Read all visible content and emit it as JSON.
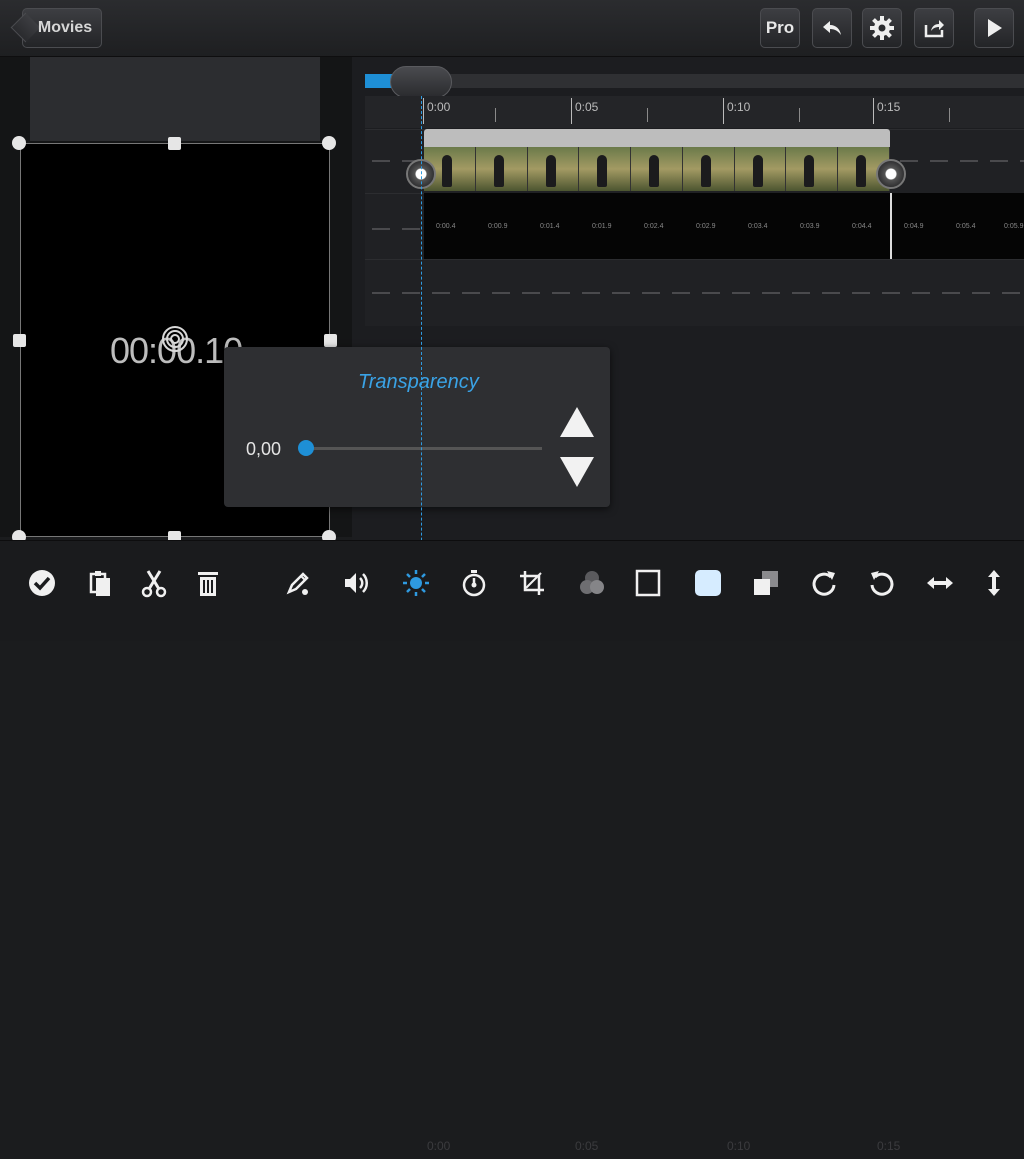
{
  "header": {
    "back_label": "Movies",
    "pro_label": "Pro"
  },
  "preview": {
    "timecode": "00:00.10"
  },
  "timeline": {
    "ruler_labels": [
      "0:00",
      "0:05",
      "0:10",
      "0:15"
    ],
    "audio_labels": [
      "0:00.4",
      "0:00.9",
      "0:01.4",
      "0:01.9",
      "0:02.4",
      "0:02.9",
      "0:03.4",
      "0:03.9",
      "0:04.4",
      "0:04.9",
      "0:05.4",
      "0:05.9"
    ],
    "scroll_progress": 0.05
  },
  "transparency": {
    "title": "Transparency",
    "value_text": "0,00",
    "level": 0.0
  },
  "icons": {
    "top": [
      "undo-icon",
      "gear-icon",
      "share-icon",
      "play-icon"
    ],
    "bottom": [
      "check-icon",
      "paste-icon",
      "scissors-icon",
      "trash-icon",
      "pen-icon",
      "volume-icon",
      "brightness-icon",
      "stopwatch-icon",
      "crop-icon",
      "color-circles-icon",
      "square-outline-icon",
      "square-filled-icon",
      "layers-icon",
      "rotate-right-icon",
      "rotate-left-icon",
      "flip-horizontal-icon",
      "flip-vertical-icon"
    ]
  },
  "colors": {
    "accent": "#1e8fd6",
    "title_accent": "#3aa3e6"
  }
}
